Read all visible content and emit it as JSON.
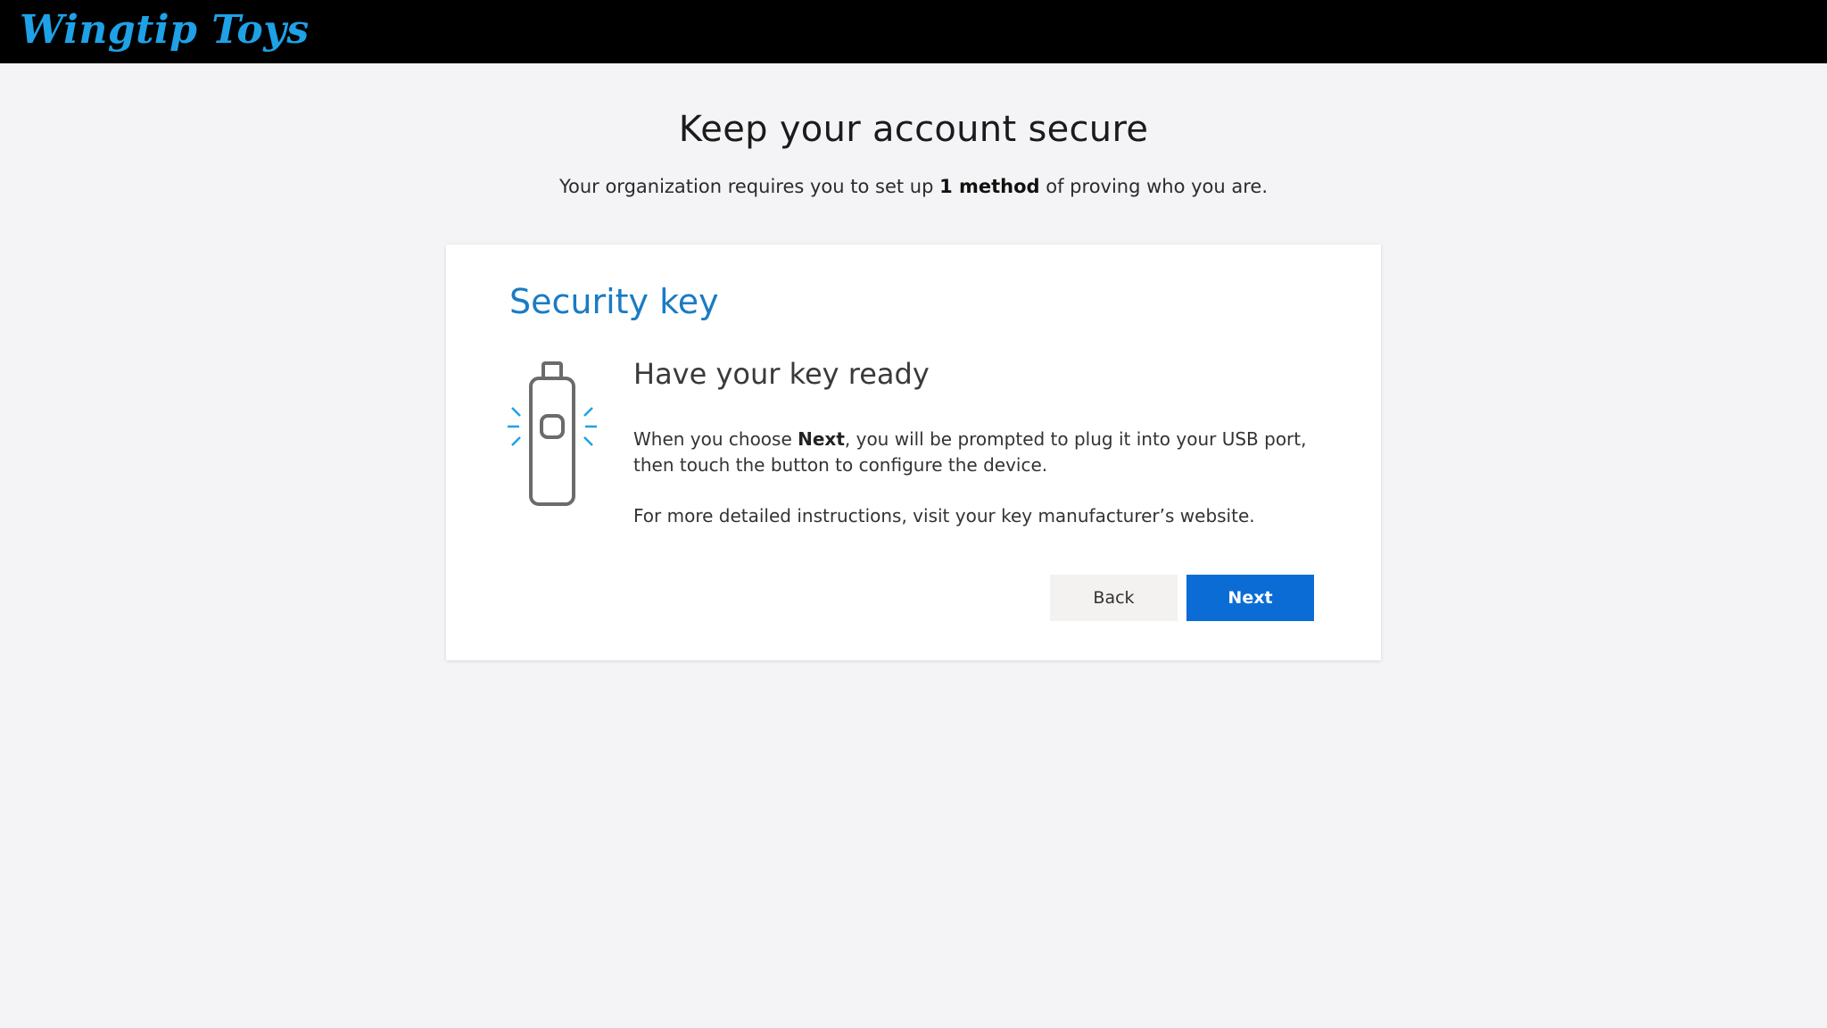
{
  "header": {
    "brand": "Wingtip Toys"
  },
  "page": {
    "title": "Keep your account secure",
    "subtitle_before": "Your organization requires you to set up ",
    "subtitle_bold": "1 method",
    "subtitle_after": " of proving who you are."
  },
  "card": {
    "title": "Security key",
    "heading": "Have your key ready",
    "instruction_before": "When you choose ",
    "instruction_bold": "Next",
    "instruction_after": ", you will be prompted to plug it into your USB port, then touch the button to configure the device.",
    "more_info": "For more detailed instructions, visit your key manufacturer’s website.",
    "illustration_icon": "security-key-icon",
    "back_label": "Back",
    "next_label": "Next"
  },
  "colors": {
    "topbar": "#000000",
    "brand": "#1ea1e6",
    "background": "#f4f3f5",
    "card_title": "#1a7bc4",
    "primary_button": "#0b6cd6",
    "secondary_button": "#f3f2f1"
  }
}
